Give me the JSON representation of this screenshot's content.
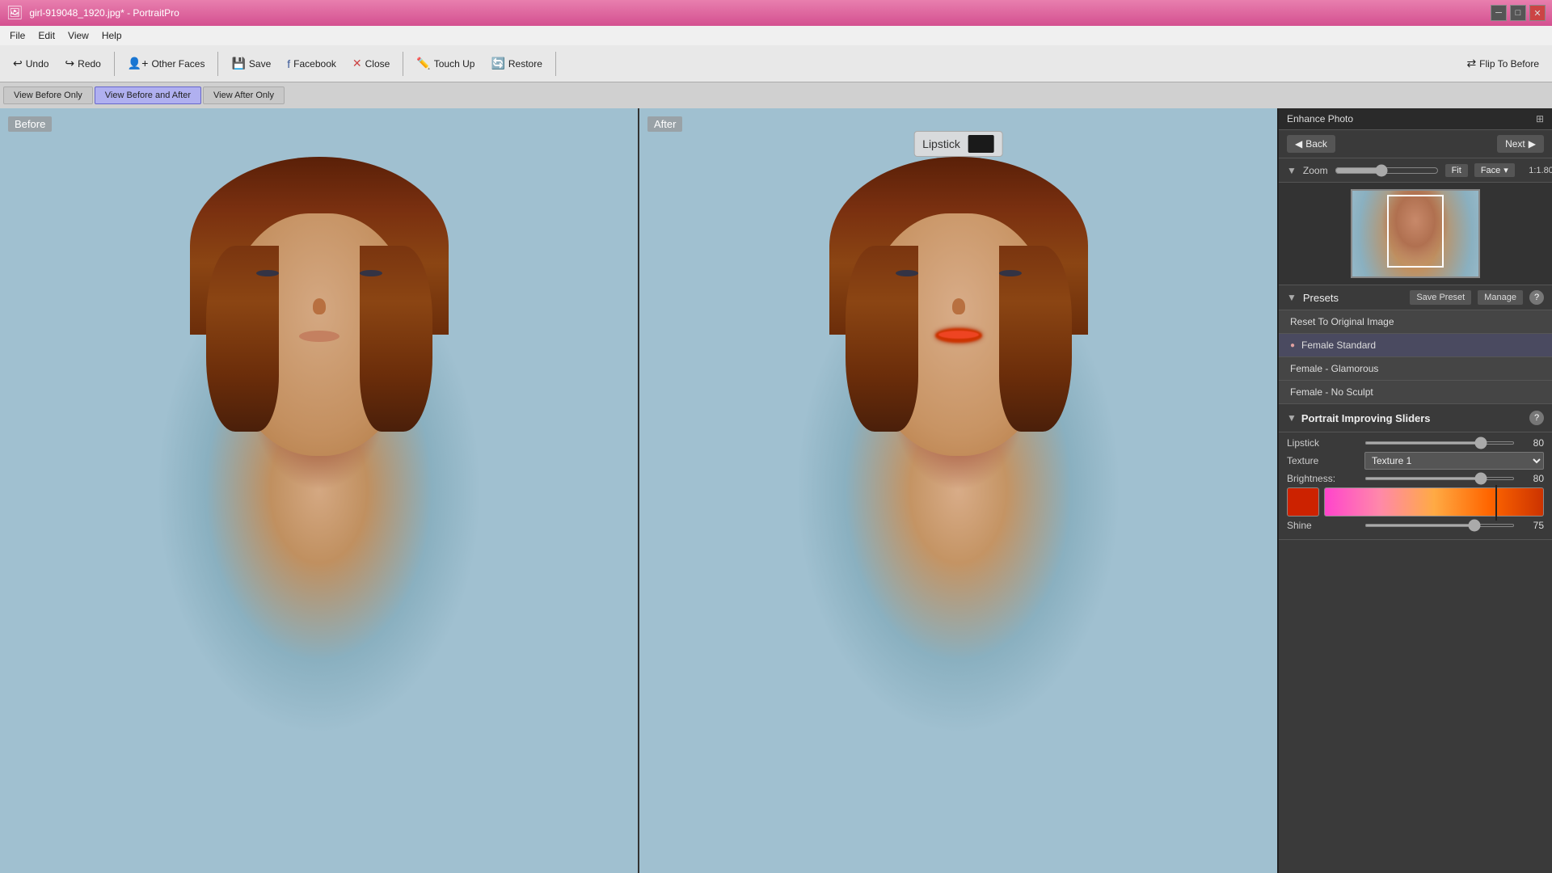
{
  "titlebar": {
    "title": "girl-919048_1920.jpg* - PortraitPro",
    "buttons": [
      "minimize",
      "maximize",
      "close"
    ]
  },
  "menubar": {
    "items": [
      "File",
      "Edit",
      "View",
      "Help"
    ]
  },
  "toolbar": {
    "undo_label": "Undo",
    "redo_label": "Redo",
    "other_faces_label": "Other Faces",
    "save_label": "Save",
    "facebook_label": "Facebook",
    "close_label": "Close",
    "touch_up_label": "Touch Up",
    "restore_label": "Restore",
    "flip_label": "Flip To Before"
  },
  "view_buttons": {
    "before_only": "View Before Only",
    "before_and_after": "View Before and After",
    "after_only": "View After Only"
  },
  "panels": {
    "before_label": "Before",
    "after_label": "After"
  },
  "lipstick_bubble": {
    "label": "Lipstick"
  },
  "right_panel": {
    "enhance_title": "Enhance Photo",
    "back_label": "Back",
    "next_label": "Next",
    "zoom_label": "Zoom",
    "zoom_fit": "Fit",
    "zoom_face": "Face",
    "zoom_value": "1:1.80",
    "presets_label": "Presets",
    "save_preset_label": "Save Preset",
    "manage_label": "Manage",
    "presets": [
      {
        "label": "Reset To Original Image",
        "active": false,
        "dot": false
      },
      {
        "label": "Female Standard",
        "active": true,
        "dot": true
      },
      {
        "label": "Female - Glamorous",
        "active": false,
        "dot": false
      },
      {
        "label": "Female - No Sculpt",
        "active": false,
        "dot": false
      }
    ],
    "sliders_title": "Portrait Improving Sliders",
    "sliders": {
      "lipstick": {
        "label": "Lipstick",
        "value": 80,
        "min": 0,
        "max": 100
      },
      "texture": {
        "label": "Texture",
        "dropdown": "Texture 1"
      },
      "brightness": {
        "label": "Brightness:",
        "value": 80,
        "min": 0,
        "max": 100
      },
      "shine": {
        "label": "Shine",
        "value": 75,
        "min": 0,
        "max": 100
      }
    }
  }
}
